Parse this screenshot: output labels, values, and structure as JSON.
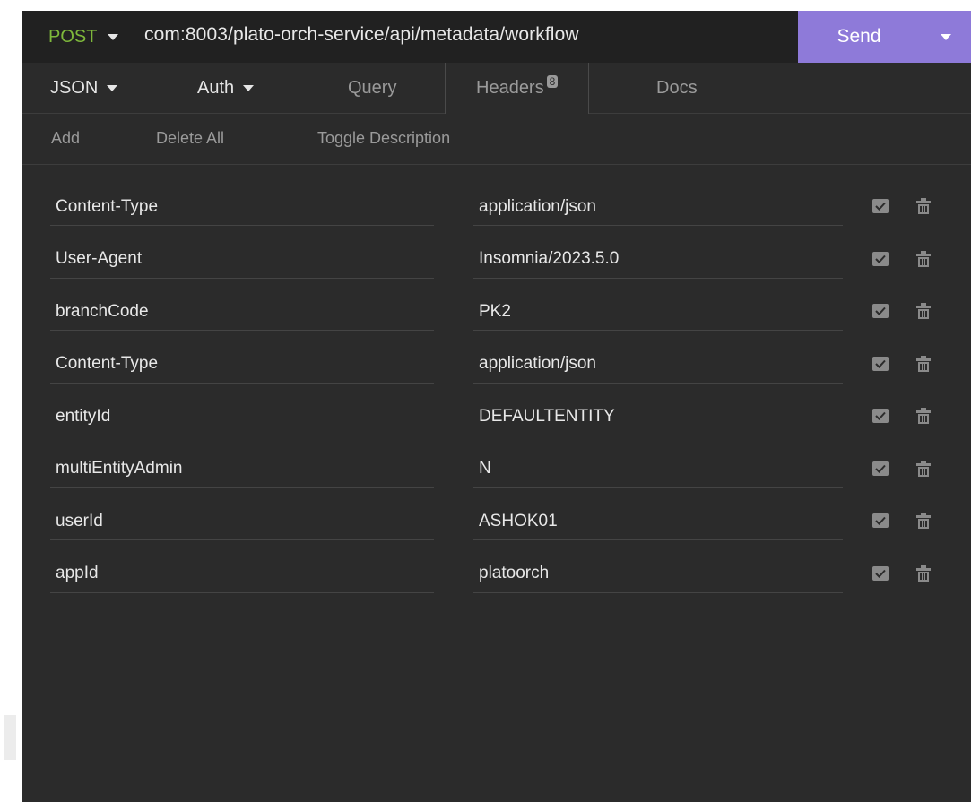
{
  "url_bar": {
    "method": "POST",
    "url": "com:8003/plato-orch-service/api/metadata/workflow",
    "send_label": "Send",
    "method_color": "#7eb83b",
    "send_color": "#8e7ad9"
  },
  "tabs": {
    "body": "JSON",
    "auth": "Auth",
    "query": "Query",
    "headers": "Headers",
    "headers_count": "8",
    "docs": "Docs",
    "active": "Headers"
  },
  "actions": {
    "add": "Add",
    "delete_all": "Delete All",
    "toggle_description": "Toggle Description"
  },
  "headers": [
    {
      "name": "Content-Type",
      "value": "application/json",
      "enabled": true
    },
    {
      "name": "User-Agent",
      "value": "Insomnia/2023.5.0",
      "enabled": true
    },
    {
      "name": "branchCode",
      "value": "PK2",
      "enabled": true
    },
    {
      "name": "Content-Type",
      "value": "application/json",
      "enabled": true
    },
    {
      "name": "entityId",
      "value": "DEFAULTENTITY",
      "enabled": true
    },
    {
      "name": "multiEntityAdmin",
      "value": "N",
      "enabled": true
    },
    {
      "name": "userId",
      "value": "ASHOK01",
      "enabled": true
    },
    {
      "name": "appId",
      "value": "platoorch",
      "enabled": true
    }
  ],
  "icons": {
    "method_dropdown": "chevron-down-icon",
    "send_dropdown": "chevron-down-icon",
    "row_toggle": "checkbox-icon",
    "row_delete": "trash-icon"
  }
}
